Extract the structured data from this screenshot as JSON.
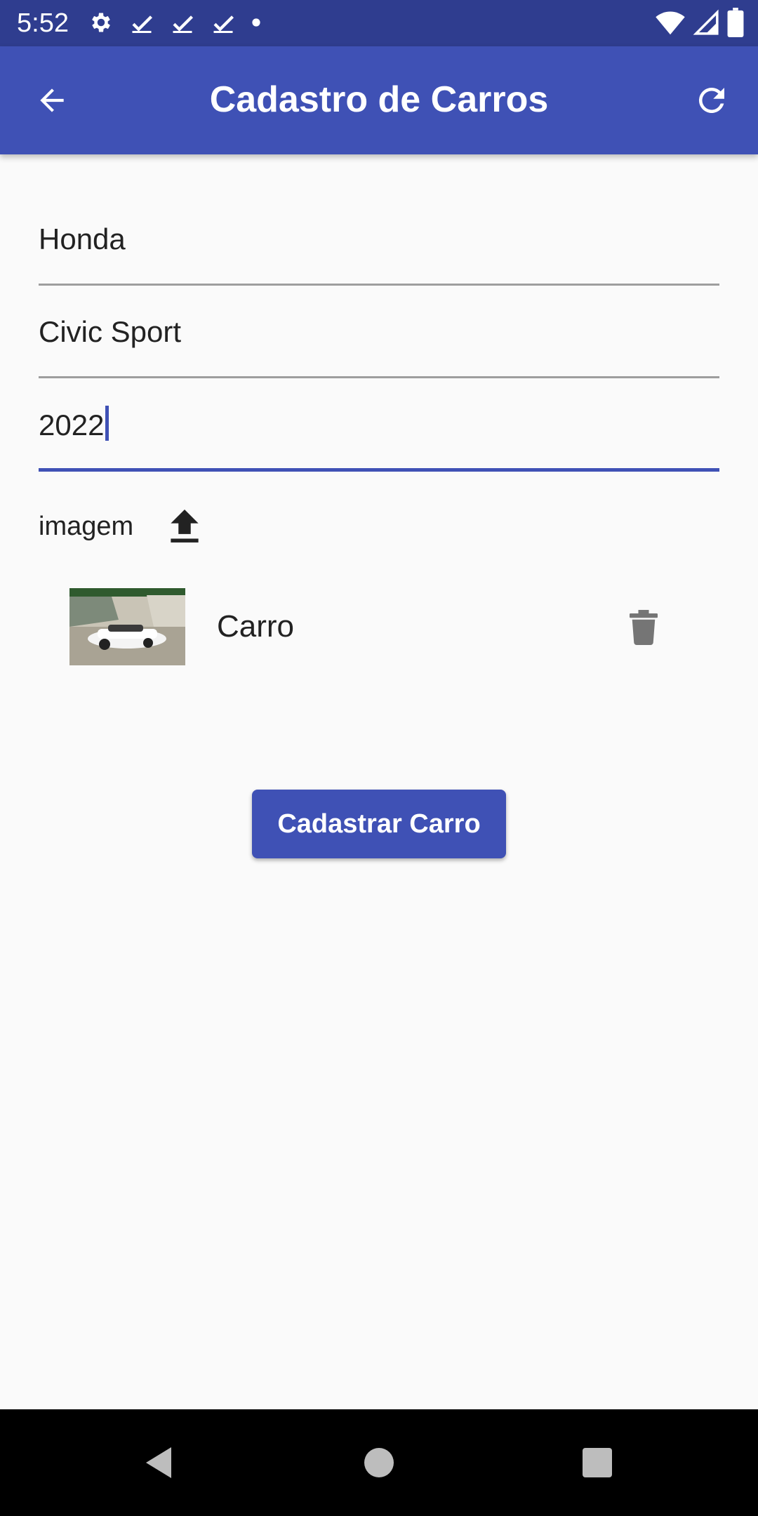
{
  "status_bar": {
    "time": "5:52"
  },
  "app_bar": {
    "title": "Cadastro de Carros"
  },
  "form": {
    "brand_value": "Honda",
    "model_value": "Civic Sport",
    "year_value": "2022"
  },
  "image_section": {
    "label": "imagem",
    "items": [
      {
        "label": "Carro"
      }
    ]
  },
  "submit": {
    "label": "Cadastrar Carro"
  },
  "colors": {
    "primary": "#3f51b5",
    "status_bar": "#2f3d8f",
    "background": "#fafafa"
  }
}
